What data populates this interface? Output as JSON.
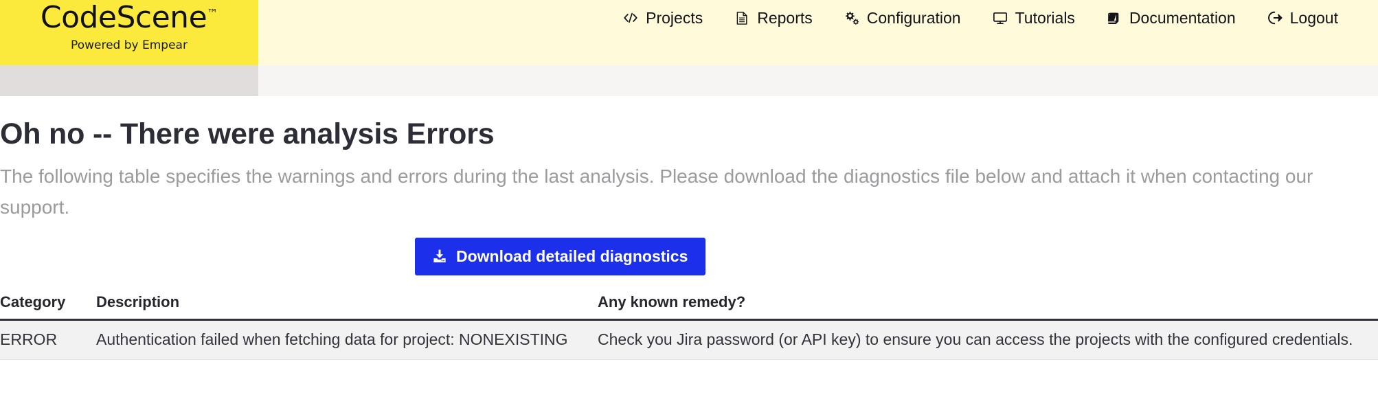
{
  "brand": {
    "name": "CodeScene",
    "trademark": "™",
    "tagline": "Powered by Empear",
    "logo_bg": "#fbea3b",
    "navbar_bg": "#fffbda"
  },
  "nav": {
    "items": [
      {
        "label": "Projects",
        "icon": "code-brackets-icon"
      },
      {
        "label": "Reports",
        "icon": "document-icon"
      },
      {
        "label": "Configuration",
        "icon": "gears-icon"
      },
      {
        "label": "Tutorials",
        "icon": "monitor-icon"
      },
      {
        "label": "Documentation",
        "icon": "book-icon"
      },
      {
        "label": "Logout",
        "icon": "sign-out-icon"
      }
    ]
  },
  "page": {
    "title": "Oh no -- There were analysis Errors",
    "description": "The following table specifies the warnings and errors during the last analysis. Please download the diagnostics file below and attach it when contacting our support."
  },
  "download_button": {
    "label": "Download detailed diagnostics",
    "icon": "download-icon",
    "color": "#1c30ec"
  },
  "table": {
    "headers": {
      "category": "Category",
      "description": "Description",
      "remedy": "Any known remedy?"
    },
    "rows": [
      {
        "category": "ERROR",
        "description": "Authentication failed when fetching data for project: NONEXISTING",
        "remedy": "Check you Jira password (or API key) to ensure you can access the projects with the configured credentials."
      }
    ]
  }
}
